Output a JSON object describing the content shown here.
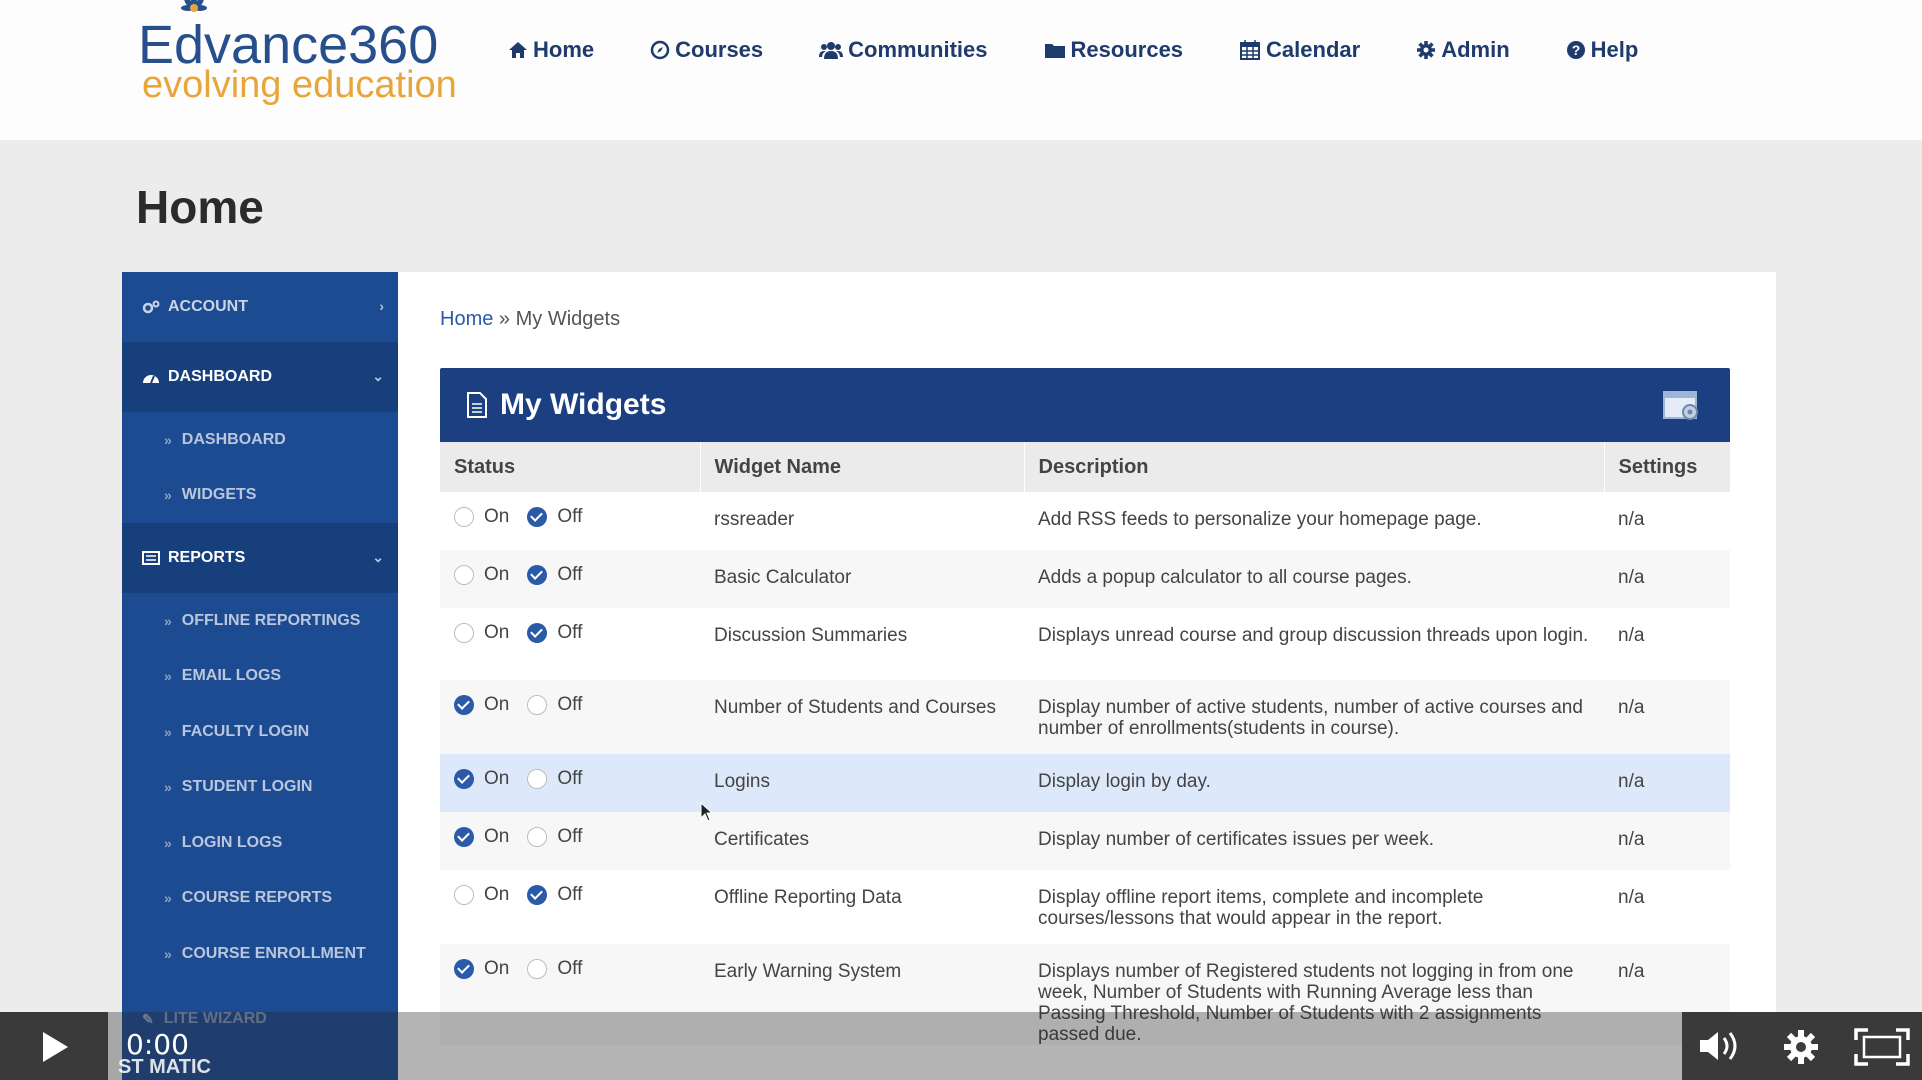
{
  "logo": {
    "name": "Edvance360",
    "tagline": "evolving education"
  },
  "nav": [
    {
      "label": "Home",
      "icon": "home-icon"
    },
    {
      "label": "Courses",
      "icon": "compass-icon"
    },
    {
      "label": "Communities",
      "icon": "users-icon"
    },
    {
      "label": "Resources",
      "icon": "folder-icon"
    },
    {
      "label": "Calendar",
      "icon": "calendar-icon"
    },
    {
      "label": "Admin",
      "icon": "gear-icon"
    },
    {
      "label": "Help",
      "icon": "help-icon"
    }
  ],
  "page": {
    "title": "Home"
  },
  "sidebar": {
    "account": "ACCOUNT",
    "dashboard": "DASHBOARD",
    "dashboard_items": [
      "DASHBOARD",
      "WIDGETS"
    ],
    "reports": "REPORTS",
    "report_items": [
      "OFFLINE REPORTINGS",
      "EMAIL LOGS",
      "FACULTY LOGIN",
      "STUDENT LOGIN",
      "LOGIN LOGS",
      "COURSE REPORTS",
      "COURSE ENROLLMENT"
    ],
    "lite_wizard": "LITE WIZARD"
  },
  "breadcrumb": {
    "home": "Home",
    "sep": "»",
    "current": "My Widgets"
  },
  "widgets": {
    "title": "My Widgets",
    "columns": [
      "Status",
      "Widget Name",
      "Description",
      "Settings"
    ],
    "on_label": "On",
    "off_label": "Off",
    "rows": [
      {
        "on": false,
        "name": "rssreader",
        "description": "Add RSS feeds to personalize your homepage page.",
        "settings": "n/a"
      },
      {
        "on": false,
        "name": "Basic Calculator",
        "description": "Adds a popup calculator to all course pages.",
        "settings": "n/a"
      },
      {
        "on": false,
        "name": "Discussion Summaries",
        "description": "Displays unread course and group discussion threads upon login.",
        "settings": "n/a"
      },
      {
        "on": true,
        "name": "Number of Students and Courses",
        "description": "Display number of active students, number of active courses and number of enrollments(students in course).",
        "settings": "n/a"
      },
      {
        "on": true,
        "name": "Logins",
        "description": "Display login by day.",
        "settings": "n/a"
      },
      {
        "on": true,
        "name": "Certificates",
        "description": "Display number of certificates issues per week.",
        "settings": "n/a"
      },
      {
        "on": false,
        "name": "Offline Reporting Data",
        "description": "Display offline report items, complete and incomplete courses/lessons that would appear in the report.",
        "settings": "n/a"
      },
      {
        "on": true,
        "name": "Early Warning System",
        "description": "Displays number of Registered students not logging in from one week, Number of Students with Running Average less than Passing Threshold, Number of Students with 2 assignments passed due.",
        "settings": "n/a"
      }
    ]
  },
  "video": {
    "time": "0:00",
    "overlay_text": "ST MATIC"
  },
  "colors": {
    "brand_blue": "#1c3f82",
    "sidebar": "#1c4b92",
    "logo_orange": "#e8a63a",
    "highlight_row": "#dde9fb"
  }
}
